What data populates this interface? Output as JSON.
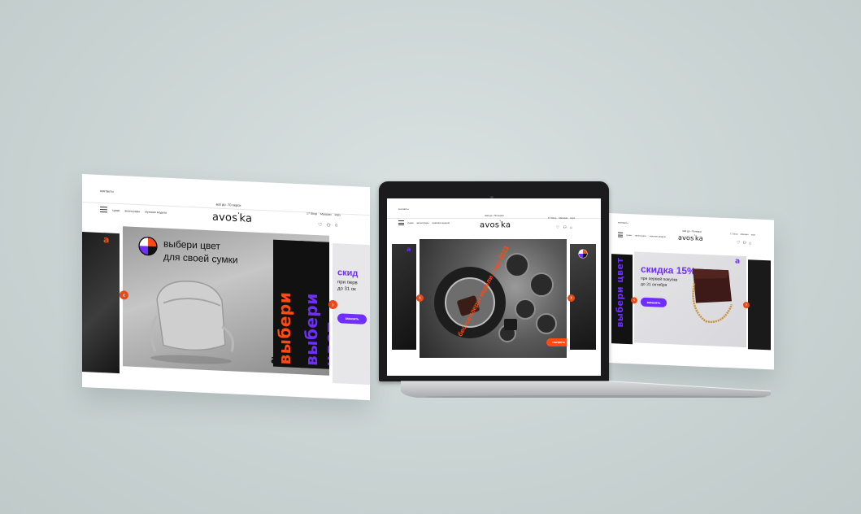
{
  "left": {
    "top_link": "контакты",
    "promo": "всё до -70 перси",
    "nav": [
      "сумки",
      "аксессуары",
      "мужские модели"
    ],
    "util": [
      "17 Shop",
      "Магазин",
      "корз"
    ],
    "logo": "avos",
    "logo_sup": "'",
    "logo_tail": "ka",
    "banner_headline_1": "выбери цвет",
    "banner_headline_2": "для своей сумки",
    "vertical_orange": "выбери цвет",
    "vertical_purple": "выбери цвет",
    "next_headline": "скид",
    "next_line_1": "при перв",
    "next_line_2": "до 31 ок",
    "next_button": "заказать",
    "brand_mark": "a"
  },
  "center": {
    "top_link": "контакты",
    "promo": "всё до -70 перси",
    "nav": [
      "сумки",
      "аксессуары",
      "мужские модели"
    ],
    "util": [
      "17 Shop",
      "Магазин",
      "корз"
    ],
    "logo": "avos",
    "logo_sup": "'",
    "logo_tail": "ka",
    "ring_text": "бестселлеры недели • топ 2023",
    "cta": "смотреть",
    "brand_mark": "a"
  },
  "right": {
    "top_link": "контакты",
    "promo": "всё до -70 перси",
    "nav": [
      "сумки",
      "аксессуары",
      "мужские модели"
    ],
    "util": [
      "17 Shop",
      "Магазин",
      "корз"
    ],
    "logo": "avos",
    "logo_sup": "'",
    "logo_tail": "ka",
    "discount": "скидка 15%",
    "line_1": "при первой покупке",
    "line_2": "до 31 октября",
    "button": "заказать",
    "vertical_prev": "выбери цвет",
    "brand_mark": "a"
  },
  "colors": {
    "accent_orange": "#ff4a14",
    "accent_purple": "#6f2dff",
    "background": "#cdd6d5"
  },
  "icons": [
    "menu-icon",
    "heart-icon",
    "user-icon",
    "bag-icon",
    "chevron-left-icon",
    "chevron-right-icon",
    "color-wheel-icon"
  ]
}
